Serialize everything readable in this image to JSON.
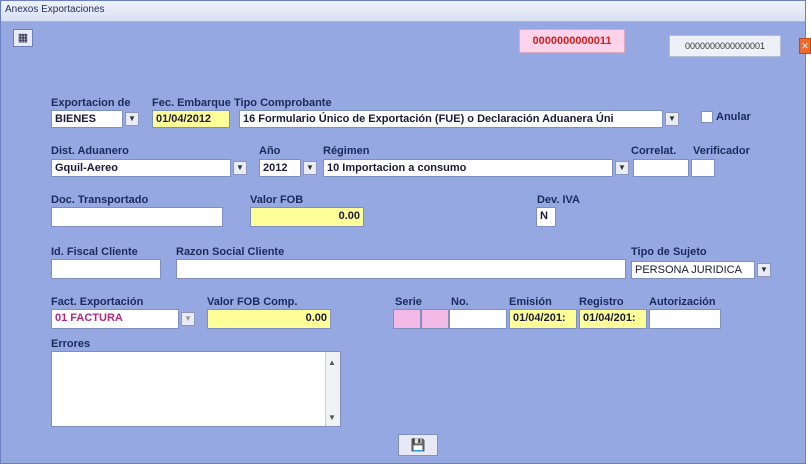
{
  "window": {
    "title": "Anexos Exportaciones"
  },
  "header": {
    "id_primary": "0000000000011",
    "id_secondary": "0000000000000001"
  },
  "form": {
    "exportacion_de": {
      "label": "Exportacion de",
      "value": "BIENES"
    },
    "fec_embarque": {
      "label": "Fec. Embarque",
      "value": "01/04/2012"
    },
    "tipo_comprobante": {
      "label": "Tipo Comprobante",
      "value": "16 Formulario Único de Exportación (FUE) o Declaración Aduanera Úni"
    },
    "anular": {
      "label": "Anular"
    },
    "dist_aduanero": {
      "label": "Dist. Aduanero",
      "value": "Gquil-Aereo"
    },
    "anio": {
      "label": "Año",
      "value": "2012"
    },
    "regimen": {
      "label": "Régimen",
      "value": "10 Importacion a consumo"
    },
    "correlat": {
      "label": "Correlat.",
      "value": ""
    },
    "verificador": {
      "label": "Verificador",
      "value": ""
    },
    "doc_transportado": {
      "label": "Doc. Transportado",
      "value": ""
    },
    "valor_fob": {
      "label": "Valor FOB",
      "value": "0.00"
    },
    "dev_iva": {
      "label": "Dev. IVA",
      "value": "N"
    },
    "id_fiscal_cliente": {
      "label": "Id. Fiscal Cliente",
      "value": ""
    },
    "razon_social_cliente": {
      "label": "Razon Social Cliente",
      "value": ""
    },
    "tipo_sujeto": {
      "label": "Tipo de Sujeto",
      "value": "PERSONA JURIDICA"
    },
    "fact_exportacion": {
      "label": "Fact. Exportación",
      "value": "01 FACTURA"
    },
    "valor_fob_comp": {
      "label": "Valor FOB Comp.",
      "value": "0.00"
    },
    "serie": {
      "label": "Serie",
      "value1": "",
      "value2": ""
    },
    "no": {
      "label": "No.",
      "value": ""
    },
    "emision": {
      "label": "Emisión",
      "value": "01/04/201:"
    },
    "registro": {
      "label": "Registro",
      "value": "01/04/201:"
    },
    "autorizacion": {
      "label": "Autorización",
      "value": ""
    },
    "errores": {
      "label": "Errores",
      "value": ""
    }
  },
  "icons": {
    "top_left": "grid-edit-icon",
    "top_right": "close-icon",
    "save": "save-icon",
    "dropdown": "chevron-down-icon"
  },
  "colors": {
    "window_bg": "#96a8e2",
    "highlight_yellow": "#ffff99",
    "highlight_pink": "#f2b8e6",
    "id_badge_text": "#cc2222"
  }
}
